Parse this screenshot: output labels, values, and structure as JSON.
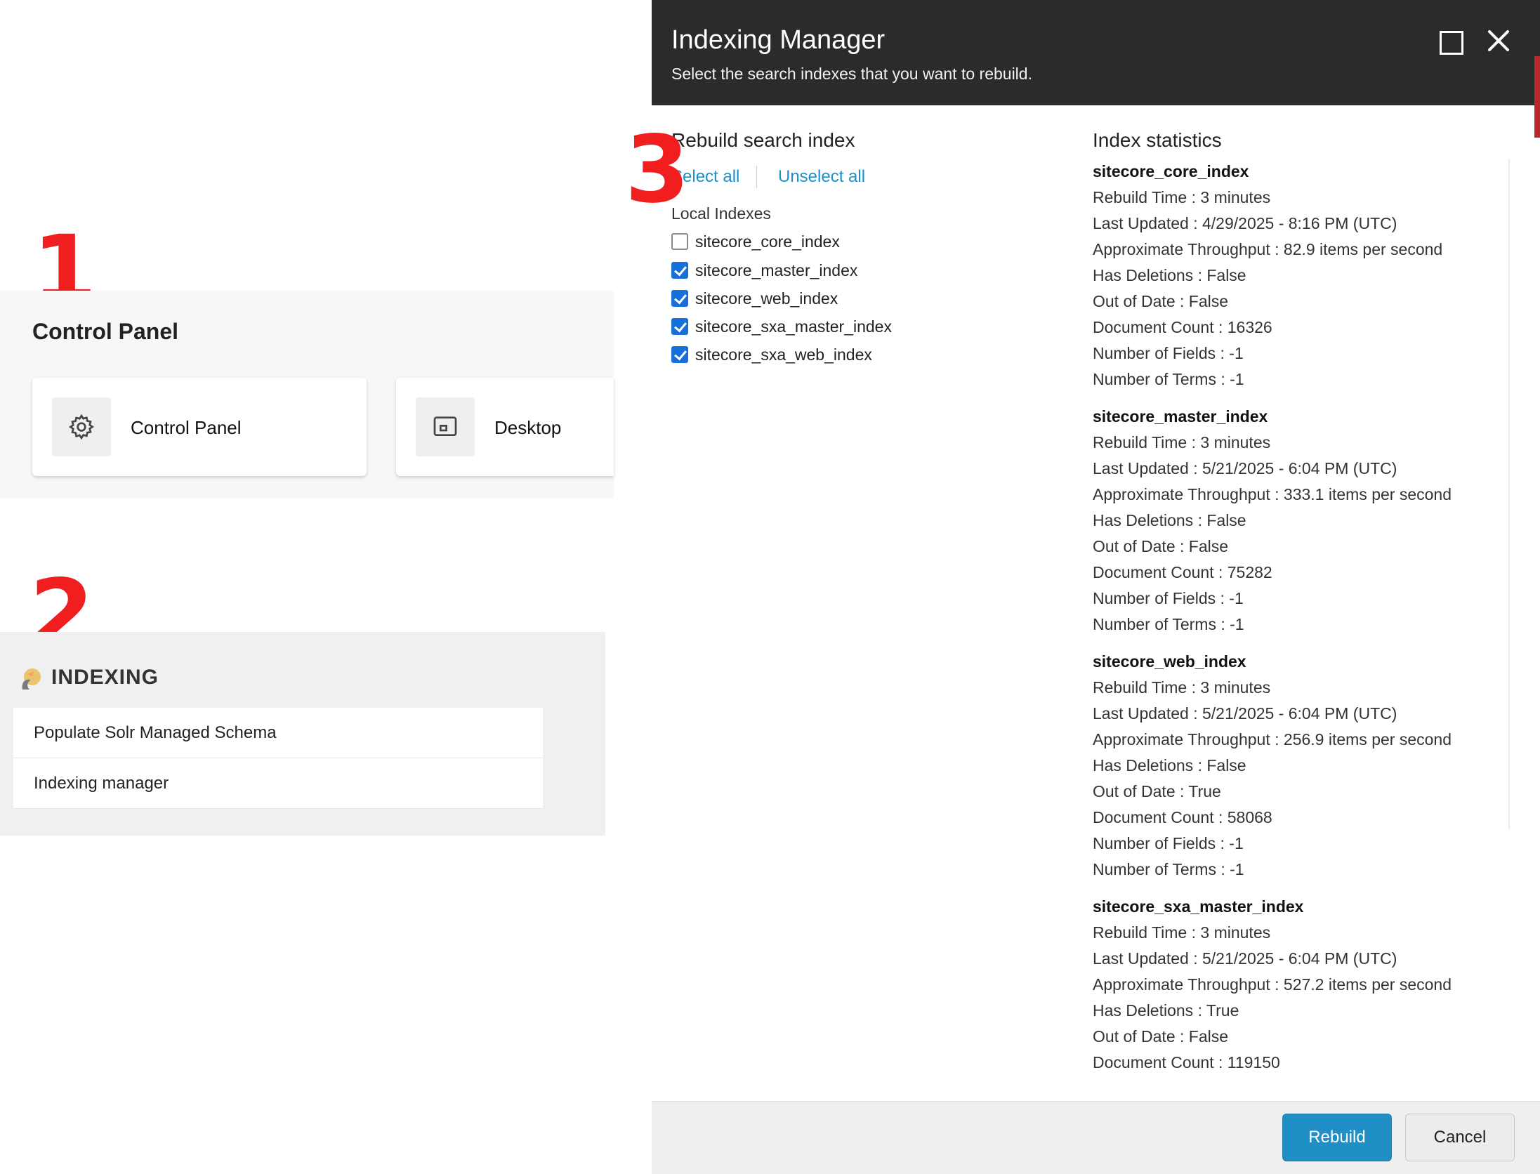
{
  "annotations": {
    "step1": "1",
    "step2": "2",
    "step3": "3"
  },
  "control_panel": {
    "title": "Control Panel",
    "cards": [
      {
        "label": "Control Panel",
        "icon": "gear-icon"
      },
      {
        "label": "Desktop",
        "icon": "desktop-icon"
      }
    ]
  },
  "indexing": {
    "title": "INDEXING",
    "icon": "indexing-icon",
    "items": [
      {
        "label": "Populate Solr Managed Schema"
      },
      {
        "label": "Indexing manager"
      }
    ]
  },
  "modal": {
    "title": "Indexing Manager",
    "subtitle": "Select the search indexes that you want to rebuild.",
    "rebuild": {
      "heading": "Rebuild search index",
      "select_all": "Select all",
      "unselect_all": "Unselect all",
      "group_label": "Local Indexes",
      "indexes": [
        {
          "name": "sitecore_core_index",
          "checked": false
        },
        {
          "name": "sitecore_master_index",
          "checked": true
        },
        {
          "name": "sitecore_web_index",
          "checked": true
        },
        {
          "name": "sitecore_sxa_master_index",
          "checked": true
        },
        {
          "name": "sitecore_sxa_web_index",
          "checked": true
        }
      ]
    },
    "statistics": {
      "heading": "Index statistics",
      "blocks": [
        {
          "name": "sitecore_core_index",
          "lines": [
            "Rebuild Time : 3 minutes",
            "Last Updated : 4/29/2025 - 8:16 PM (UTC)",
            "Approximate Throughput : 82.9 items per second",
            "Has Deletions : False",
            "Out of Date : False",
            "Document Count : 16326",
            "Number of Fields : -1",
            "Number of Terms : -1"
          ]
        },
        {
          "name": "sitecore_master_index",
          "lines": [
            "Rebuild Time : 3 minutes",
            "Last Updated : 5/21/2025 - 6:04 PM (UTC)",
            "Approximate Throughput : 333.1 items per second",
            "Has Deletions : False",
            "Out of Date : False",
            "Document Count : 75282",
            "Number of Fields : -1",
            "Number of Terms : -1"
          ]
        },
        {
          "name": "sitecore_web_index",
          "lines": [
            "Rebuild Time : 3 minutes",
            "Last Updated : 5/21/2025 - 6:04 PM (UTC)",
            "Approximate Throughput : 256.9 items per second",
            "Has Deletions : False",
            "Out of Date : True",
            "Document Count : 58068",
            "Number of Fields : -1",
            "Number of Terms : -1"
          ]
        },
        {
          "name": "sitecore_sxa_master_index",
          "lines": [
            "Rebuild Time : 3 minutes",
            "Last Updated : 5/21/2025 - 6:04 PM (UTC)",
            "Approximate Throughput : 527.2 items per second",
            "Has Deletions : True",
            "Out of Date : False",
            "Document Count : 119150"
          ]
        }
      ]
    },
    "footer": {
      "rebuild_label": "Rebuild",
      "cancel_label": "Cancel"
    },
    "colors": {
      "header_bg": "#2b2b2b",
      "primary": "#1f8fc6",
      "link": "#1a91c8",
      "checkbox": "#1670d8",
      "annotation": "#f01e1e"
    }
  }
}
